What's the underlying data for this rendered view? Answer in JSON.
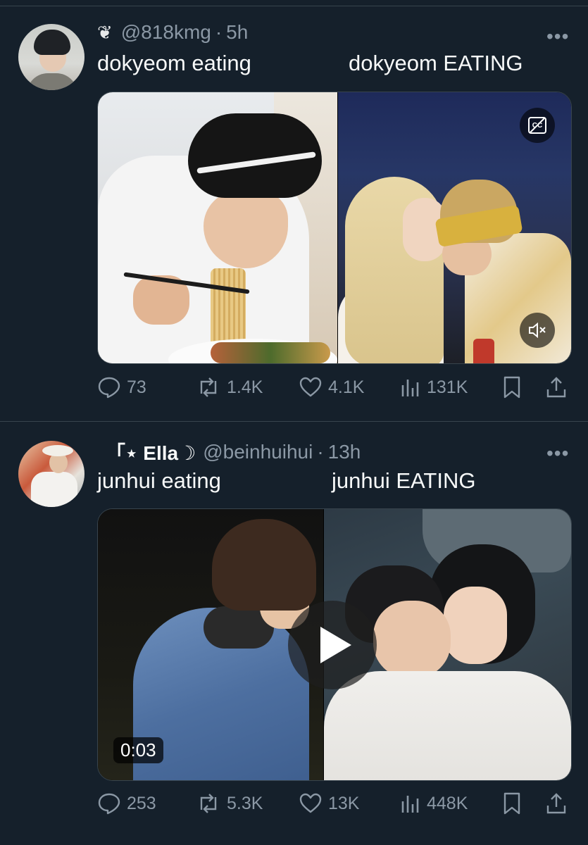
{
  "tweets": [
    {
      "user_emoji": "❦",
      "display_name": "",
      "handle": "@818kmg",
      "time": "5h",
      "caption_left": "dokyeom eating",
      "caption_right": "dokyeom EATING",
      "media_icons": [
        "captions-off-icon",
        "volume-mute-icon"
      ],
      "stats": {
        "replies": "73",
        "reposts": "1.4K",
        "likes": "4.1K",
        "views": "131K"
      }
    },
    {
      "user_emoji": "",
      "display_name": "「⋆ Ella☽",
      "handle": "@beinhuihui",
      "time": "13h",
      "caption_left": "junhui eating",
      "caption_right": "junhui EATING",
      "duration": "0:03",
      "stats": {
        "replies": "253",
        "reposts": "5.3K",
        "likes": "13K",
        "views": "448K"
      }
    }
  ],
  "colors": {
    "background": "#15202b",
    "secondary_text": "#8b98a5",
    "divider": "#38444d"
  },
  "more_label": "•••"
}
